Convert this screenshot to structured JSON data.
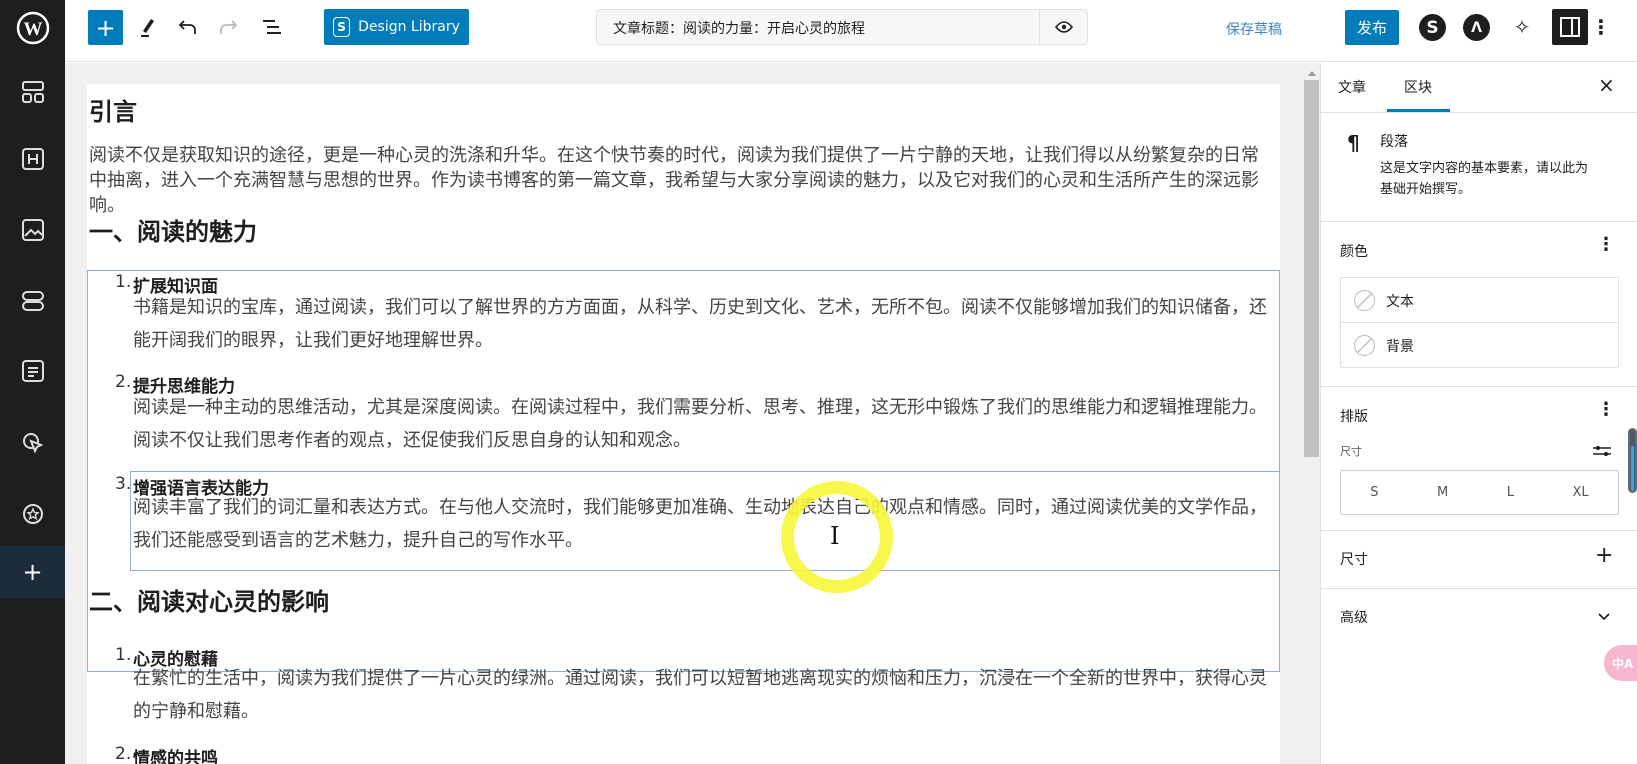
{
  "left_sidebar": {
    "items": [
      "wordpress-logo",
      "patterns-icon",
      "heading-icon",
      "image-icon",
      "layout-icon",
      "page-icon",
      "cursor-click-icon",
      "star-badge-icon",
      "add-icon"
    ]
  },
  "toolbar": {
    "design_library": "Design Library",
    "design_library_letter": "S",
    "title": "文章标题：阅读的力量：开启心灵的旅程",
    "save_draft": "保存草稿",
    "publish": "发布",
    "colors": {
      "accent": "#007cba",
      "dark": "#1e1e1e"
    }
  },
  "content": {
    "h_intro": "引言",
    "intro": "阅读不仅是获取知识的途径，更是一种心灵的洗涤和升华。在这个快节奏的时代，阅读为我们提供了一片宁静的天地，让我们得以从纷繁复杂的日常中抽离，进入一个充满智慧与思想的世界。作为读书博客的第一篇文章，我希望与大家分享阅读的魅力，以及它对我们的心灵和生活所产生的深远影响。",
    "h1": "一、阅读的魅力",
    "list1": [
      {
        "num": "1.",
        "title": "扩展知识面",
        "text": "书籍是知识的宝库，通过阅读，我们可以了解世界的方方面面，从科学、历史到文化、艺术，无所不包。阅读不仅能够增加我们的知识储备，还能开阔我们的眼界，让我们更好地理解世界。"
      },
      {
        "num": "2.",
        "title": "提升思维能力",
        "text": "阅读是一种主动的思维活动，尤其是深度阅读。在阅读过程中，我们需要分析、思考、推理，这无形中锻炼了我们的思维能力和逻辑推理能力。阅读不仅让我们思考作者的观点，还促使我们反思自身的认知和观念。"
      },
      {
        "num": "3.",
        "title": "增强语言表达能力",
        "text": "阅读丰富了我们的词汇量和表达方式。在与他人交流时，我们能够更加准确、生动地表达自己的观点和情感。同时，通过阅读优美的文学作品，我们还能感受到语言的艺术魅力，提升自己的写作水平。"
      }
    ],
    "h2": "二、阅读对心灵的影响",
    "list2": [
      {
        "num": "1.",
        "title": "心灵的慰藉",
        "text": "在繁忙的生活中，阅读为我们提供了一片心灵的绿洲。通过阅读，我们可以短暂地逃离现实的烦恼和压力，沉浸在一个全新的世界中，获得心灵的宁静和慰藉。"
      },
      {
        "num": "2.",
        "title": "情感的共鸣",
        "text": ""
      }
    ]
  },
  "panel": {
    "tabs": [
      "文章",
      "区块"
    ],
    "active_tab": "区块",
    "block_name": "段落",
    "block_desc": "这是文字内容的基本要素，请以此为基础开始撰写。",
    "color_title": "颜色",
    "color_items": [
      "文本",
      "背景"
    ],
    "typography_title": "排版",
    "size_label": "尺寸",
    "sizes": [
      "S",
      "M",
      "L",
      "XL"
    ],
    "dimensions_title": "尺寸",
    "advanced_title": "高级",
    "translate_badge": "中A"
  }
}
